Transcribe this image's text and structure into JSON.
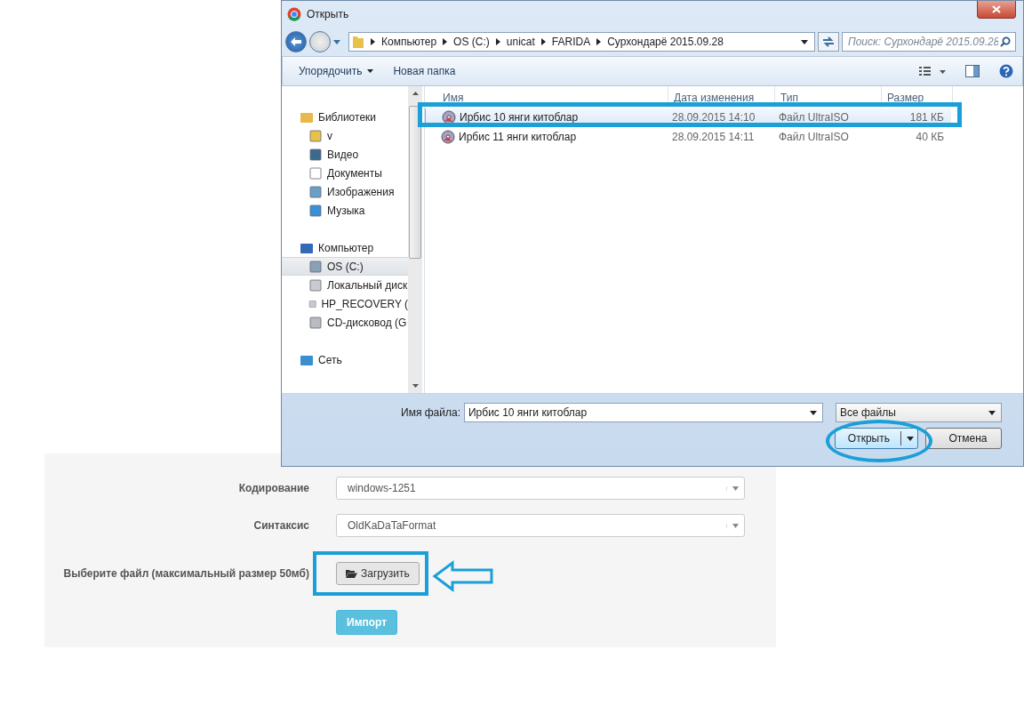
{
  "dialog": {
    "title": "Открыть",
    "breadcrumb": [
      "Компьютер",
      "OS (C:)",
      "unicat",
      "FARIDA",
      "Сурхондарё 2015.09.28"
    ],
    "search": {
      "placeholder": "Поиск: Сурхондарё 2015.09.28"
    },
    "toolbar": [
      {
        "label": "Упорядочить",
        "dropdown": true
      },
      {
        "label": "Новая папка",
        "dropdown": false
      }
    ],
    "nav": [
      {
        "label": "Библиотеки",
        "kind": "library",
        "selected": false,
        "children": [
          {
            "label": "v",
            "kind": "folder",
            "selected": false
          },
          {
            "label": "Видео",
            "kind": "video",
            "selected": false
          },
          {
            "label": "Документы",
            "kind": "documents",
            "selected": false
          },
          {
            "label": "Изображения",
            "kind": "images",
            "selected": false
          },
          {
            "label": "Музыка",
            "kind": "music",
            "selected": false
          }
        ]
      },
      {
        "label": "Компьютер",
        "kind": "computer",
        "selected": false,
        "children": [
          {
            "label": "OS (C:)",
            "kind": "os-drive",
            "selected": true
          },
          {
            "label": "Локальный диск",
            "kind": "drive",
            "selected": false
          },
          {
            "label": "HP_RECOVERY (",
            "kind": "drive",
            "selected": false
          },
          {
            "label": "CD-дисковод (G",
            "kind": "cd",
            "selected": false
          }
        ]
      },
      {
        "label": "Сеть",
        "kind": "network",
        "selected": false
      }
    ],
    "columns": [
      "Имя",
      "Дата изменения",
      "Тип",
      "Размер"
    ],
    "files": [
      {
        "name": "Ирбис 10 янги китоблар",
        "date": "28.09.2015 14:10",
        "type": "Файл UltraISO",
        "size": "181 КБ",
        "selected": true
      },
      {
        "name": "Ирбис 11 янги китоблар",
        "date": "28.09.2015 14:11",
        "type": "Файл UltraISO",
        "size": "40 КБ",
        "selected": false
      }
    ],
    "filename": {
      "label": "Имя файла:",
      "value": "Ирбис 10 янги китоблар"
    },
    "filter": "Все файлы",
    "open_button": "Открыть",
    "cancel_button": "Отмена"
  },
  "form": {
    "fields": [
      {
        "kind": "select",
        "label": "Кодирование",
        "value": "windows-1251"
      },
      {
        "kind": "select",
        "label": "Синтаксис",
        "value": "OldKaDaTaFormat"
      },
      {
        "kind": "file",
        "label": "Выберите файл (максимальный размер 50мб)",
        "button": "Загрузить"
      }
    ],
    "submit": "Импорт"
  }
}
